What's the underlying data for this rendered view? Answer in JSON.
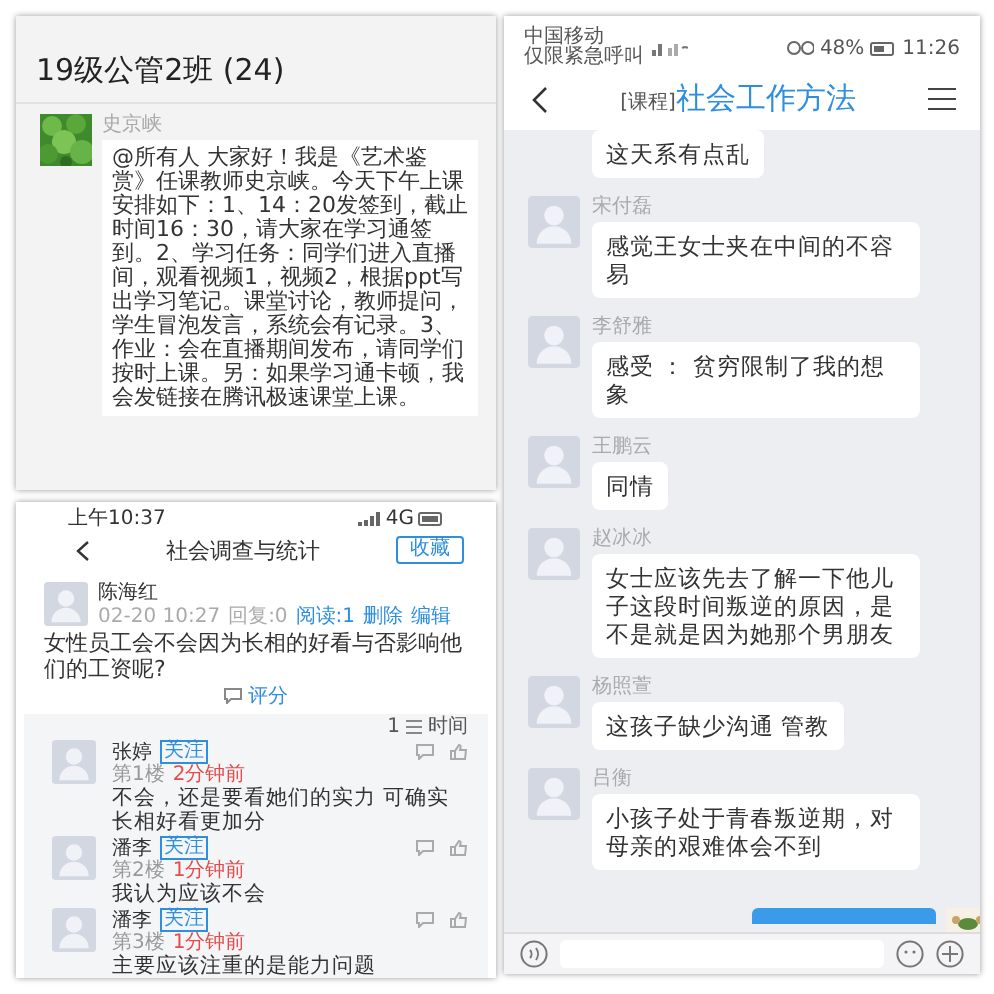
{
  "group_chat": {
    "title": "19级公管2班 (24)",
    "messages": [
      {
        "sender": "史京峡",
        "text": "@所有人 大家好！我是《艺术鉴赏》任课教师史京峡。今天下午上课安排如下：1、14：20发签到，截止时间16：30，请大家在学习通签到。2、学习任务：同学们进入直播间，观看视频1，视频2，根据ppt写出学习笔记。课堂讨论，教师提问，学生冒泡发言，系统会有记录。3、作业：会在直播期间发布，请同学们按时上课。另：如果学习通卡顿，我会发链接在腾讯极速课堂上课。"
      }
    ]
  },
  "forum": {
    "status_time": "上午10:37",
    "network": "4G",
    "title": "社会调查与统计",
    "favorite_button": "收藏",
    "post": {
      "author": "陈海红",
      "time": "02-20 10:27",
      "replies": "回复:0",
      "reads": "阅读:1",
      "actions": [
        "删除",
        "编辑"
      ],
      "question": "女性员工会不会因为长相的好看与否影响他们的工资呢?",
      "rate": "评分"
    },
    "sort": {
      "count": "1",
      "label": "时间"
    },
    "comments": [
      {
        "name": "张婷",
        "follow": "关注",
        "floor": "第1楼",
        "time": "2分钟前",
        "text": "不会，还是要看她们的实力 可确实长相好看更加分"
      },
      {
        "name": "潘李",
        "follow": "关注",
        "floor": "第2楼",
        "time": "1分钟前",
        "text": "我认为应该不会"
      },
      {
        "name": "潘李",
        "follow": "关注",
        "floor": "第3楼",
        "time": "1分钟前",
        "text": "主要应该注重的是能力问题"
      }
    ]
  },
  "course_chat": {
    "carrier": [
      "中国移动",
      "仅限紧急呼叫"
    ],
    "battery": "48%",
    "time": "11:26",
    "title_tag": "[课程]",
    "title": "社会工作方法",
    "messages": [
      {
        "kind": "partial",
        "text": "这天系有点乱"
      },
      {
        "kind": "incoming",
        "name": "宋付磊",
        "text": "感觉王女士夹在中间的不容易"
      },
      {
        "kind": "incoming",
        "name": "李舒雅",
        "text": "感受 ： 贫穷限制了我的想象"
      },
      {
        "kind": "incoming",
        "name": "王鹏云",
        "text": "同情"
      },
      {
        "kind": "incoming",
        "name": "赵冰冰",
        "text": "女士应该先去了解一下他儿子这段时间叛逆的原因，是不是就是因为她那个男朋友"
      },
      {
        "kind": "incoming",
        "name": "杨照萱",
        "text": "这孩子缺少沟通 管教"
      },
      {
        "kind": "incoming",
        "name": "吕衡",
        "text": "小孩子处于青春叛逆期，对母亲的艰难体会不到"
      },
      {
        "kind": "outgoing"
      }
    ]
  }
}
